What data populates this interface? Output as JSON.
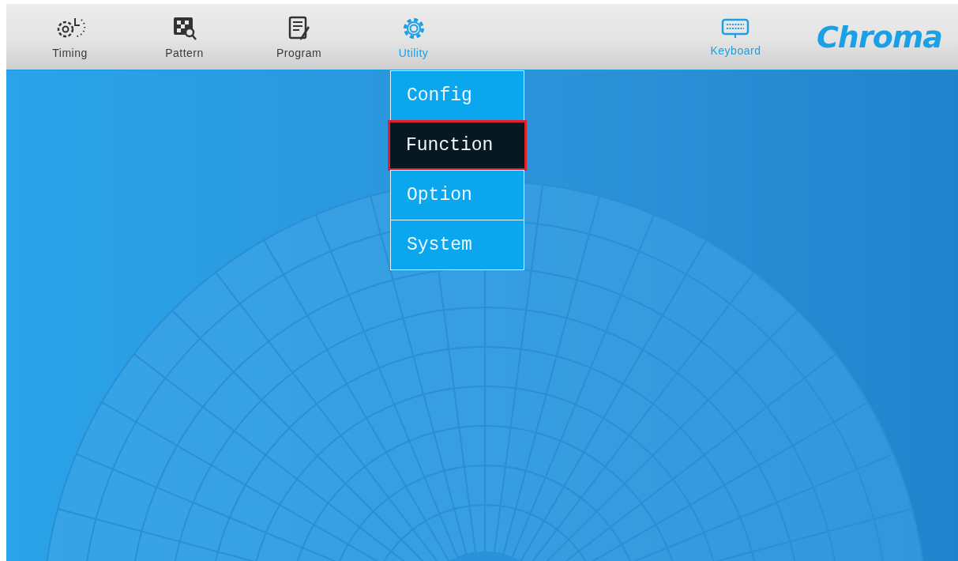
{
  "toolbar": {
    "tabs": [
      {
        "label": "Timing",
        "selected": false
      },
      {
        "label": "Pattern",
        "selected": false
      },
      {
        "label": "Program",
        "selected": false
      },
      {
        "label": "Utility",
        "selected": true
      }
    ],
    "keyboard": {
      "label": "Keyboard"
    },
    "logo": "Chroma"
  },
  "menu": {
    "items": [
      {
        "label": "Config",
        "selected": false
      },
      {
        "label": "Function",
        "selected": true
      },
      {
        "label": "Option",
        "selected": false
      },
      {
        "label": "System",
        "selected": false
      }
    ]
  }
}
